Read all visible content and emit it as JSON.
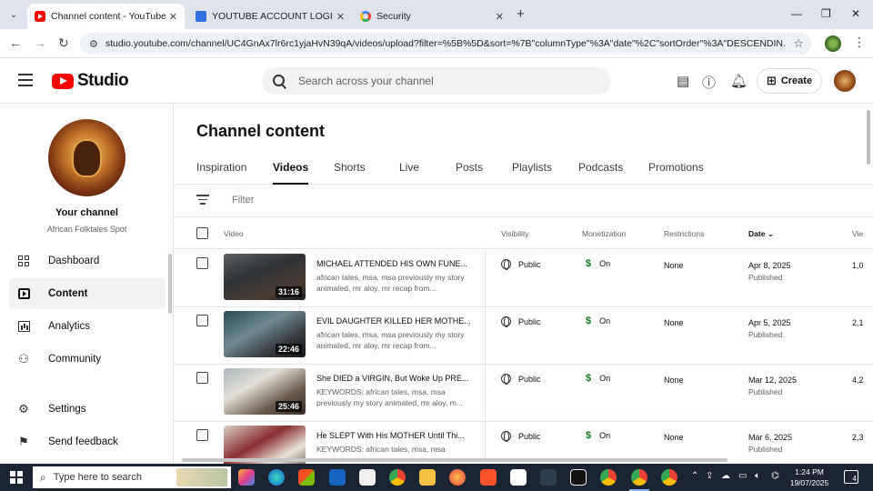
{
  "browser": {
    "tabs": [
      {
        "label": "Channel content - YouTube Stu",
        "active": true
      },
      {
        "label": "YOUTUBE ACCOUNT LOGINS",
        "active": false
      },
      {
        "label": "Security",
        "active": false
      }
    ],
    "url": "studio.youtube.com/channel/UC4GnAx7lr6rc1yjaHvN39qA/videos/upload?filter=%5B%5D&sort=%7B\"columnType\"%3A\"date\"%2C\"sortOrder\"%3A\"DESCENDIN..."
  },
  "header": {
    "logo_text": "Studio",
    "search_placeholder": "Search across your channel",
    "create_label": "Create"
  },
  "sidebar": {
    "channel_title": "Your channel",
    "channel_name": "African Folktales Spot",
    "items": [
      {
        "label": "Dashboard",
        "icon": "dashboard-icon",
        "active": false
      },
      {
        "label": "Content",
        "icon": "content-icon",
        "active": true
      },
      {
        "label": "Analytics",
        "icon": "analytics-icon",
        "active": false
      },
      {
        "label": "Community",
        "icon": "community-icon",
        "active": false
      },
      {
        "label": "Settings",
        "icon": "gear-icon",
        "active": false
      },
      {
        "label": "Send feedback",
        "icon": "feedback-icon",
        "active": false
      }
    ]
  },
  "main": {
    "title": "Channel content",
    "tabs": [
      {
        "label": "Inspiration",
        "active": false
      },
      {
        "label": "Videos",
        "active": true
      },
      {
        "label": "Shorts",
        "active": false
      },
      {
        "label": "Live",
        "active": false
      },
      {
        "label": "Posts",
        "active": false
      },
      {
        "label": "Playlists",
        "active": false
      },
      {
        "label": "Podcasts",
        "active": false
      },
      {
        "label": "Promotions",
        "active": false
      }
    ],
    "filter_placeholder": "Filter",
    "columns": {
      "video": "Video",
      "visibility": "Visibility",
      "monetization": "Monetization",
      "restrictions": "Restrictions",
      "date": "Date",
      "views": "Vie"
    },
    "rows": [
      {
        "title": "MICHAEL ATTENDED HIS OWN FUNE...",
        "description": "african tales, msa, msa previously my story animated, mr aloy, mr recap from...",
        "duration": "31:16",
        "visibility": "Public",
        "monetization": "On",
        "restrictions": "None",
        "date": "Apr 8, 2025",
        "status": "Published",
        "views": "1,0"
      },
      {
        "title": "EVIL DAUGHTER KILLED HER MOTHE...",
        "description": "african tales, msa, msa previously my story animated, mr aloy, mr recap from...",
        "duration": "22:46",
        "visibility": "Public",
        "monetization": "On",
        "restrictions": "None",
        "date": "Apr 5, 2025",
        "status": "Published",
        "views": "2,1"
      },
      {
        "title": "She DIED a VIRGIN, But Woke Up PRE...",
        "description": "KEYWORDS: african tales, msa, msa previously my story animated, mr aloy, m...",
        "duration": "25:46",
        "visibility": "Public",
        "monetization": "On",
        "restrictions": "None",
        "date": "Mar 12, 2025",
        "status": "Published",
        "views": "4,2"
      },
      {
        "title": "He SLEPT With His MOTHER Until Thi...",
        "description": "KEYWORDS: african tales, msa, msa",
        "duration": "",
        "visibility": "Public",
        "monetization": "On",
        "restrictions": "None",
        "date": "Mar 6, 2025",
        "status": "Published",
        "views": "2,3"
      }
    ]
  },
  "taskbar": {
    "search_placeholder": "Type here to search",
    "time": "1:24 PM",
    "date": "19/07/2025",
    "notifications": "4"
  },
  "colors": {
    "brand_red": "#ff0000",
    "monetization_green": "#107516",
    "taskbar": "#1b2433"
  }
}
